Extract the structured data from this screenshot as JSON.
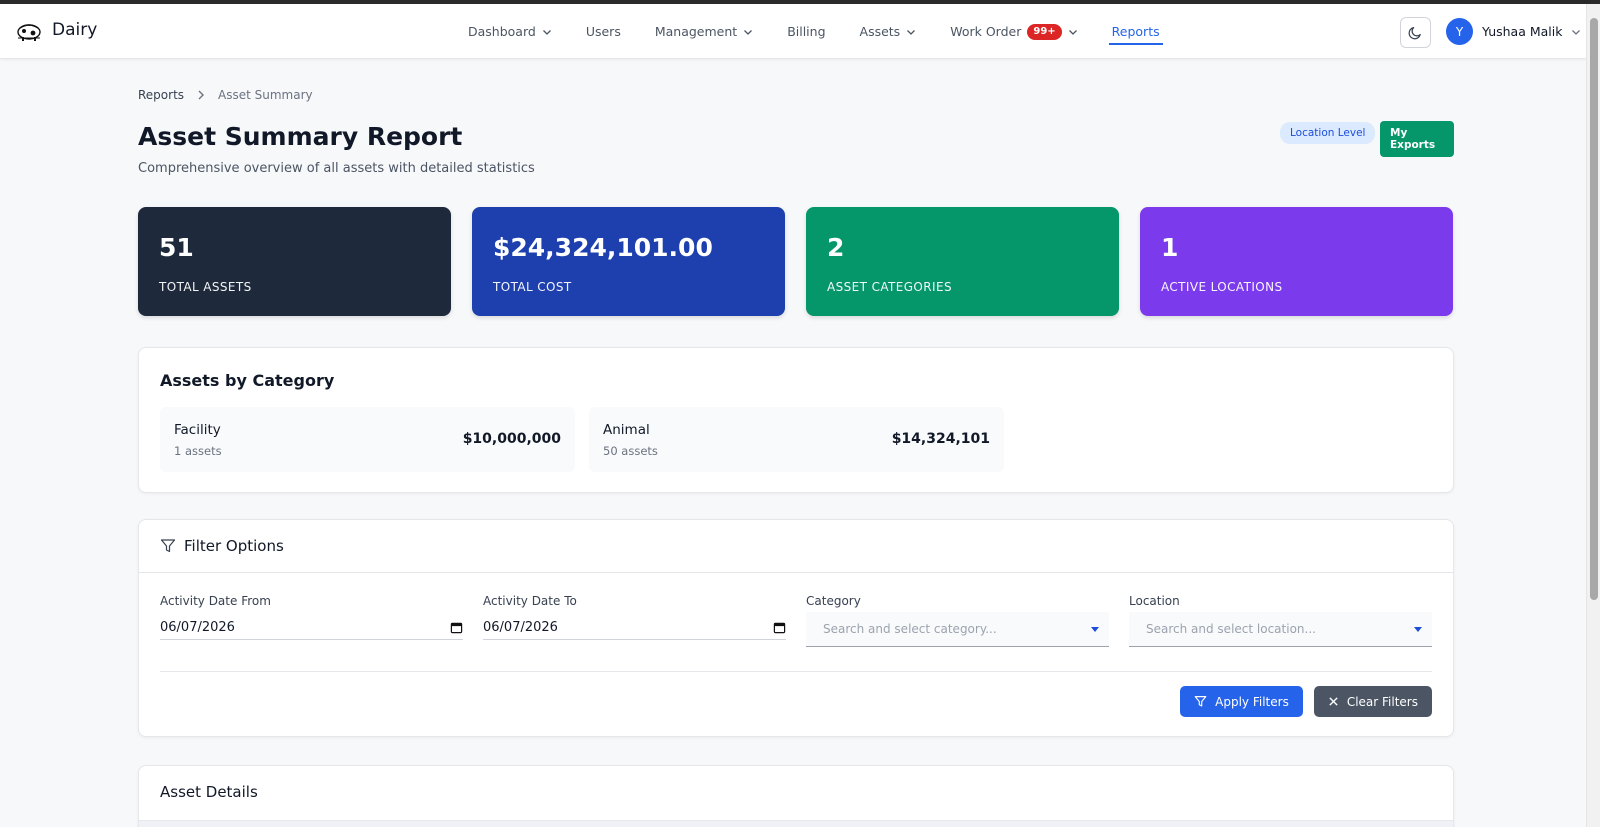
{
  "header": {
    "brand": "Dairy",
    "nav": [
      {
        "label": "Dashboard",
        "dropdown": true
      },
      {
        "label": "Users",
        "dropdown": false
      },
      {
        "label": "Management",
        "dropdown": true
      },
      {
        "label": "Billing",
        "dropdown": false
      },
      {
        "label": "Assets",
        "dropdown": true
      },
      {
        "label": "Work Order",
        "dropdown": true,
        "badge": "99+"
      },
      {
        "label": "Reports",
        "dropdown": false,
        "active": true
      }
    ],
    "user": {
      "initial": "Y",
      "name": "Yushaa Malik"
    }
  },
  "breadcrumb": {
    "parent": "Reports",
    "current": "Asset Summary"
  },
  "page": {
    "title": "Asset Summary Report",
    "subtitle": "Comprehensive overview of all assets with detailed statistics",
    "location_pill": "Location Level",
    "exports_button": "My Exports"
  },
  "stats": [
    {
      "value": "51",
      "label": "TOTAL ASSETS",
      "color": "#1e293b"
    },
    {
      "value": "$24,324,101.00",
      "label": "TOTAL COST",
      "color": "#1e40af"
    },
    {
      "value": "2",
      "label": "ASSET CATEGORIES",
      "color": "#059669"
    },
    {
      "value": "1",
      "label": "ACTIVE LOCATIONS",
      "color": "#7c3aed"
    }
  ],
  "categories": {
    "title": "Assets by Category",
    "items": [
      {
        "name": "Facility",
        "count": "1 assets",
        "amount": "$10,000,000"
      },
      {
        "name": "Animal",
        "count": "50 assets",
        "amount": "$14,324,101"
      }
    ]
  },
  "filters": {
    "title": "Filter Options",
    "date_from": {
      "label": "Activity Date From",
      "value": "06/07/2026"
    },
    "date_to": {
      "label": "Activity Date To",
      "value": "06/07/2026"
    },
    "category": {
      "label": "Category",
      "placeholder": "Search and select category..."
    },
    "location": {
      "label": "Location",
      "placeholder": "Search and select location..."
    },
    "apply_label": "Apply Filters",
    "clear_label": "Clear Filters"
  },
  "details": {
    "title": "Asset Details"
  },
  "colors": {
    "accent": "#2563eb",
    "danger": "#dc2626",
    "success": "#059669"
  }
}
